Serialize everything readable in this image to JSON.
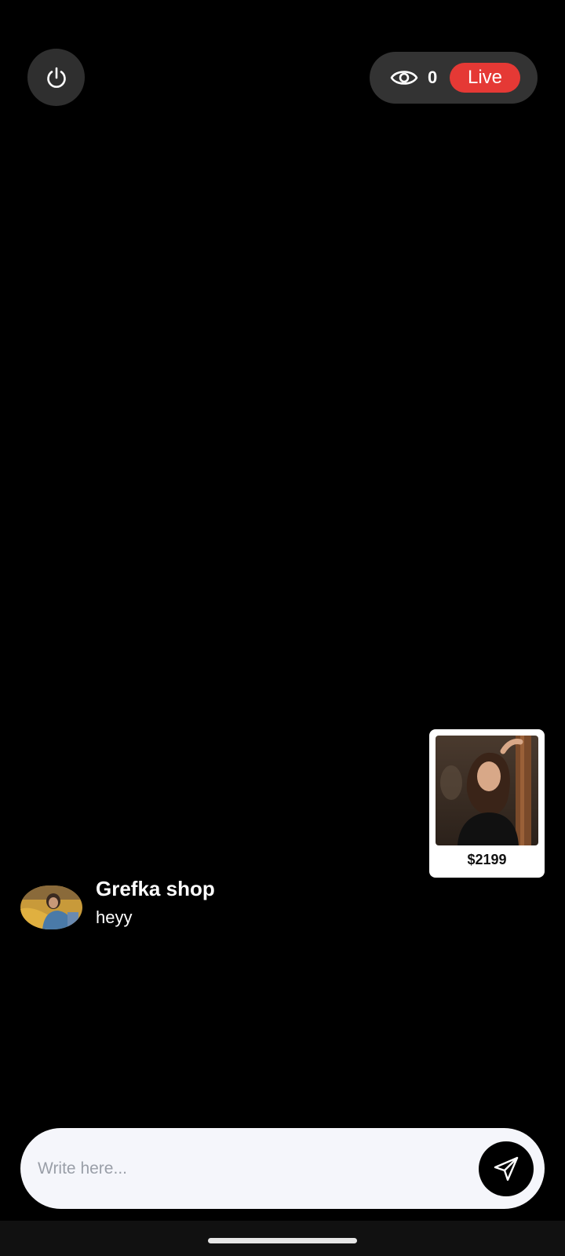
{
  "header": {
    "power_icon": "power-icon",
    "viewer_icon": "eye-icon",
    "viewer_count": "0",
    "live_label": "Live",
    "live_color": "#e53935"
  },
  "product": {
    "price": "$2199"
  },
  "chat": {
    "messages": [
      {
        "name": "Grefka shop",
        "text": "heyy"
      }
    ]
  },
  "composer": {
    "placeholder": "Write here...",
    "value": "",
    "send_icon": "send-icon"
  }
}
